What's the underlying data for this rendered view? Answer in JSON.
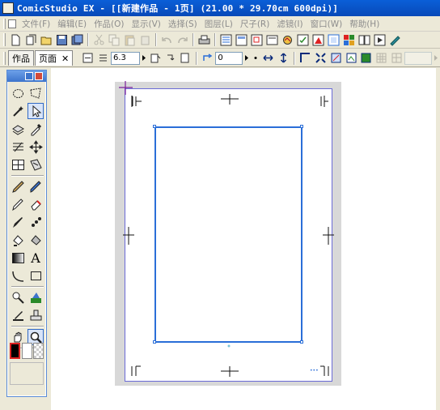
{
  "window": {
    "title": "ComicStudio EX - [[新建作品 - 1页] (21.00 * 29.70cm 600dpi)]"
  },
  "menu": {
    "items": [
      "文件(F)",
      "编辑(E)",
      "作品(O)",
      "显示(V)",
      "选择(S)",
      "图层(L)",
      "尺子(R)",
      "滤镜(I)",
      "窗口(W)",
      "帮助(H)"
    ]
  },
  "toolbar2": {
    "tab_work": "作品",
    "tab_page": "页面",
    "tab_close": "✕",
    "zoom_value": "6.3",
    "rotate_value": "0"
  },
  "palette": {
    "text_tool_glyph": "A"
  },
  "colors": {
    "titlebar": "#0a5fd8",
    "frame_border": "#2a6ed8",
    "page_border": "#6b6bd6",
    "palette_header": "#3d74cc"
  },
  "icons": {
    "palette_minimize": "minimize-icon",
    "palette_close": "close-icon"
  }
}
